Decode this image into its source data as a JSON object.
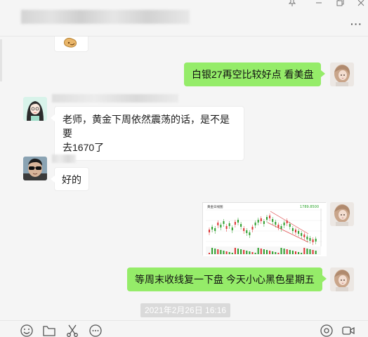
{
  "window": {
    "controls": [
      "pin-icon",
      "minimize-icon",
      "maximize-icon"
    ],
    "more_icon": "more-dots-icon"
  },
  "messages": [
    {
      "side": "out",
      "text": "白银27再空比较好点  看美盘"
    },
    {
      "side": "in",
      "line1": "老师，黄金下周依然震荡的话，是不是要",
      "line2": "去1670了"
    },
    {
      "side": "in",
      "text": "好的"
    },
    {
      "side": "out",
      "type": "image",
      "image_title": "黄金日线图",
      "image_price": "1789.8500"
    },
    {
      "side": "out",
      "text": "等周末收线复一下盘  今天小心黑色星期五"
    }
  ],
  "timestamp": "2021年2月26日 16:16",
  "toolbar": [
    "emoji-icon",
    "folder-icon",
    "scissors-icon",
    "chat-history-icon",
    "voice-call-icon",
    "video-call-icon"
  ],
  "colors": {
    "outgoing_bubble": "#95ec69",
    "incoming_bubble": "#ffffff",
    "background": "#f5f5f5",
    "timestamp_bg": "#dadada"
  }
}
